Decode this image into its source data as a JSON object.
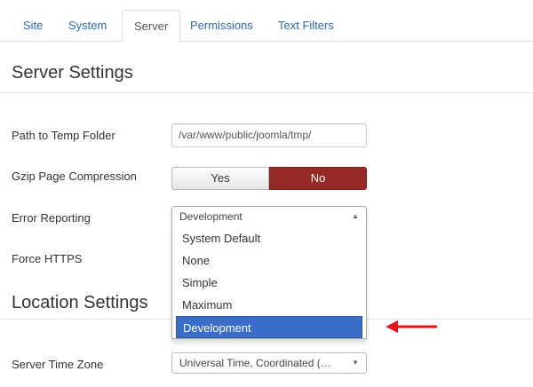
{
  "tabs": [
    {
      "label": "Site"
    },
    {
      "label": "System"
    },
    {
      "label": "Server",
      "active": true
    },
    {
      "label": "Permissions"
    },
    {
      "label": "Text Filters"
    }
  ],
  "server_settings": {
    "title": "Server Settings",
    "temp_path": {
      "label": "Path to Temp Folder",
      "value": "/var/www/public/joomla/tmp/"
    },
    "gzip": {
      "label": "Gzip Page Compression",
      "yes_label": "Yes",
      "no_label": "No",
      "selected": "No"
    },
    "error_reporting": {
      "label": "Error Reporting",
      "value": "Development",
      "expanded": true,
      "options": [
        "System Default",
        "None",
        "Simple",
        "Maximum",
        "Development"
      ],
      "selected_option": "Development"
    },
    "force_https": {
      "label": "Force HTTPS"
    }
  },
  "location_settings": {
    "title": "Location Settings",
    "timezone": {
      "label": "Server Time Zone",
      "value": "Universal Time, Coordinated (…"
    }
  },
  "colors": {
    "tab_link": "#2a69b8",
    "no_active": "#952a26",
    "option_highlight": "#3a6ec6",
    "arrow": "#e3141b"
  },
  "icons": {
    "select_open": "caret-up-icon",
    "select_closed": "caret-down-icon",
    "annotation": "red-arrow-icon"
  }
}
